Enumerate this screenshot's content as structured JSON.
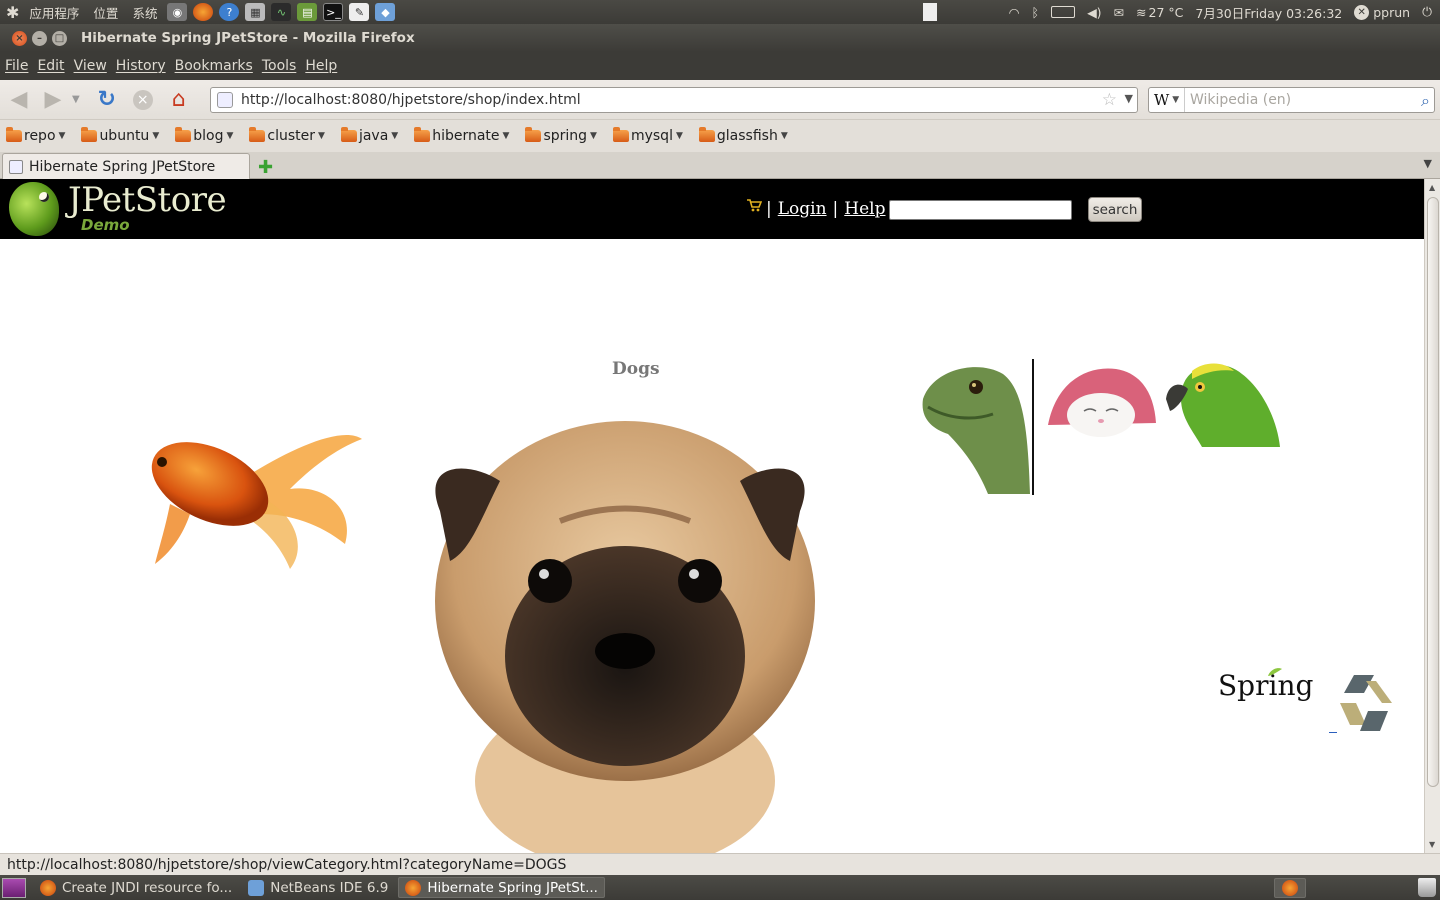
{
  "top_panel": {
    "menus": [
      "应用程序",
      "位置",
      "系统"
    ],
    "weather": "27 °C",
    "clock": "7月30日Friday 03:26:32",
    "user": "pprun"
  },
  "window": {
    "title": "Hibernate Spring JPetStore - Mozilla Firefox"
  },
  "menubar": {
    "items": [
      "File",
      "Edit",
      "View",
      "History",
      "Bookmarks",
      "Tools",
      "Help"
    ]
  },
  "navbar": {
    "url": "http://localhost:8080/hjpetstore/shop/index.html",
    "search_placeholder": "Wikipedia (en)",
    "search_engine": "W"
  },
  "bookmarks": [
    "repo",
    "ubuntu",
    "blog",
    "cluster",
    "java",
    "hibernate",
    "spring",
    "mysql",
    "glassfish"
  ],
  "tabs": {
    "active_label": "Hibernate Spring JPetStore"
  },
  "page": {
    "logo_title": "JPetStore",
    "logo_subtitle": "Demo",
    "nav": {
      "sep": "|",
      "login": "Login",
      "help": "Help"
    },
    "search_button": "search",
    "category_title": "Dogs",
    "footer_logo_spring": "Spring"
  },
  "statusbar": {
    "text": "http://localhost:8080/hjpetstore/shop/viewCategory.html?categoryName=DOGS"
  },
  "taskbar": {
    "tasks": [
      "Create JNDI resource fo...",
      "NetBeans IDE 6.9",
      "Hibernate Spring JPetSt..."
    ]
  },
  "colors": {
    "header_bg": "#000000",
    "logo_demo": "#7aa83b",
    "category_title": "#777777",
    "ubuntu_panel": "#3c3b37"
  }
}
